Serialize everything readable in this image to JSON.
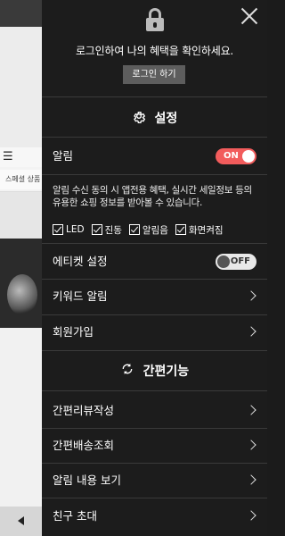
{
  "background": {
    "menu_icon": "hamburger-icon",
    "category_text": "스페셜 상품",
    "back_icon": "arrow-left-icon"
  },
  "drawer": {
    "close_icon": "close-icon",
    "lock_icon": "lock-icon",
    "login_message": "로그인하여 나의 혜택을 확인하세요.",
    "login_button": "로그인 하기",
    "settings": {
      "icon": "gear-icon",
      "title": "설정"
    },
    "notification": {
      "label": "알림",
      "toggle_label": "ON",
      "enabled": true,
      "description": "알림 수신 동의 시 앱전용 혜택, 실시간 세일정보 등의 유용한 쇼핑 정보를 받아볼 수 있습니다.",
      "options": [
        {
          "label": "LED",
          "checked": true
        },
        {
          "label": "진동",
          "checked": true
        },
        {
          "label": "알림음",
          "checked": true
        },
        {
          "label": "화면켜짐",
          "checked": true
        }
      ]
    },
    "etiquette": {
      "label": "에티켓 설정",
      "toggle_label": "OFF",
      "enabled": false
    },
    "keyword_alert": "키워드 알림",
    "signup": "회원가입",
    "quick": {
      "icon": "refresh-icon",
      "title": "간편기능"
    },
    "quick_items": [
      "간편리뷰작성",
      "간편배송조회",
      "알림 내용 보기",
      "친구 초대"
    ]
  },
  "colors": {
    "accent_on": "#f25c5c",
    "drawer_bg": "#1c1c1c"
  }
}
